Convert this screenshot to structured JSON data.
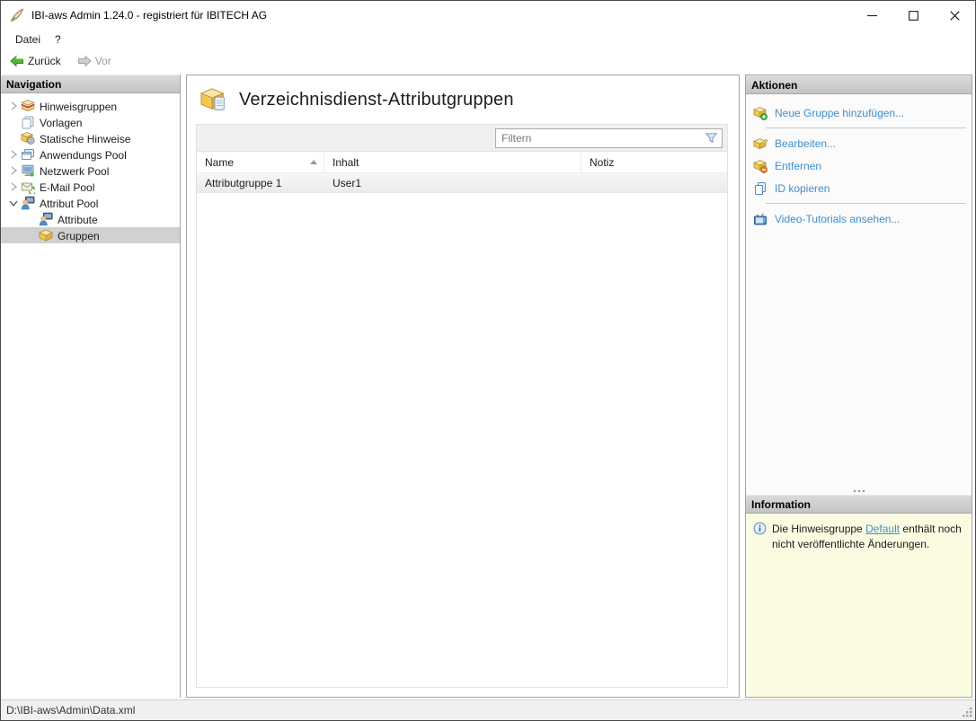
{
  "window": {
    "title": "IBI-aws Admin 1.24.0 - registriert für IBITECH AG",
    "app_icon": "quill-icon"
  },
  "menu": {
    "items": [
      {
        "label": "Datei"
      },
      {
        "label": "?"
      }
    ]
  },
  "toolbar": {
    "back_label": "Zurück",
    "forward_label": "Vor"
  },
  "navigation": {
    "header": "Navigation",
    "items": [
      {
        "label": "Hinweisgruppen",
        "icon": "notice-groups-icon",
        "expandable": true
      },
      {
        "label": "Vorlagen",
        "icon": "templates-icon"
      },
      {
        "label": "Statische Hinweise",
        "icon": "static-notices-icon"
      },
      {
        "label": "Anwendungs Pool",
        "icon": "application-pool-icon",
        "expandable": true
      },
      {
        "label": "Netzwerk Pool",
        "icon": "network-pool-icon",
        "expandable": true
      },
      {
        "label": "E-Mail Pool",
        "icon": "email-pool-icon",
        "expandable": true
      },
      {
        "label": "Attribut Pool",
        "icon": "attribute-pool-icon",
        "expanded": true
      },
      {
        "label": "Attribute",
        "icon": "attributes-icon",
        "child": true
      },
      {
        "label": "Gruppen",
        "icon": "groups-icon",
        "child": true,
        "selected": true
      }
    ]
  },
  "main": {
    "title": "Verzeichnisdienst-Attributgruppen",
    "filter_placeholder": "Filtern",
    "table": {
      "columns": [
        "Name",
        "Inhalt",
        "Notiz"
      ],
      "sorted_column": "Name",
      "sort_direction": "ascending",
      "rows": [
        {
          "name": "Attributgruppe 1",
          "inhalt": "User1",
          "notiz": ""
        }
      ]
    }
  },
  "actions": {
    "header": "Aktionen",
    "items": [
      {
        "label": "Neue Gruppe hinzufügen...",
        "icon": "group-add-icon"
      },
      {
        "label": "Bearbeiten...",
        "icon": "group-edit-icon"
      },
      {
        "label": "Entfernen",
        "icon": "group-remove-icon"
      },
      {
        "label": "ID kopieren",
        "icon": "copy-icon"
      },
      {
        "label": "Video-Tutorials ansehen...",
        "icon": "video-tutorials-icon"
      }
    ]
  },
  "information": {
    "header": "Information",
    "message_prefix": "Die Hinweisgruppe ",
    "link_text": "Default",
    "message_suffix": " enthält noch nicht veröffentlichte Änderungen."
  },
  "statusbar": {
    "path": "D:\\IBI-aws\\Admin\\Data.xml"
  },
  "colors": {
    "link_blue": "#3f8ecd",
    "selection_gray": "#d1d1d1",
    "info_background": "#fbfbe2",
    "header_gradient_top": "#dadada",
    "header_gradient_bottom": "#c3c3c3"
  }
}
